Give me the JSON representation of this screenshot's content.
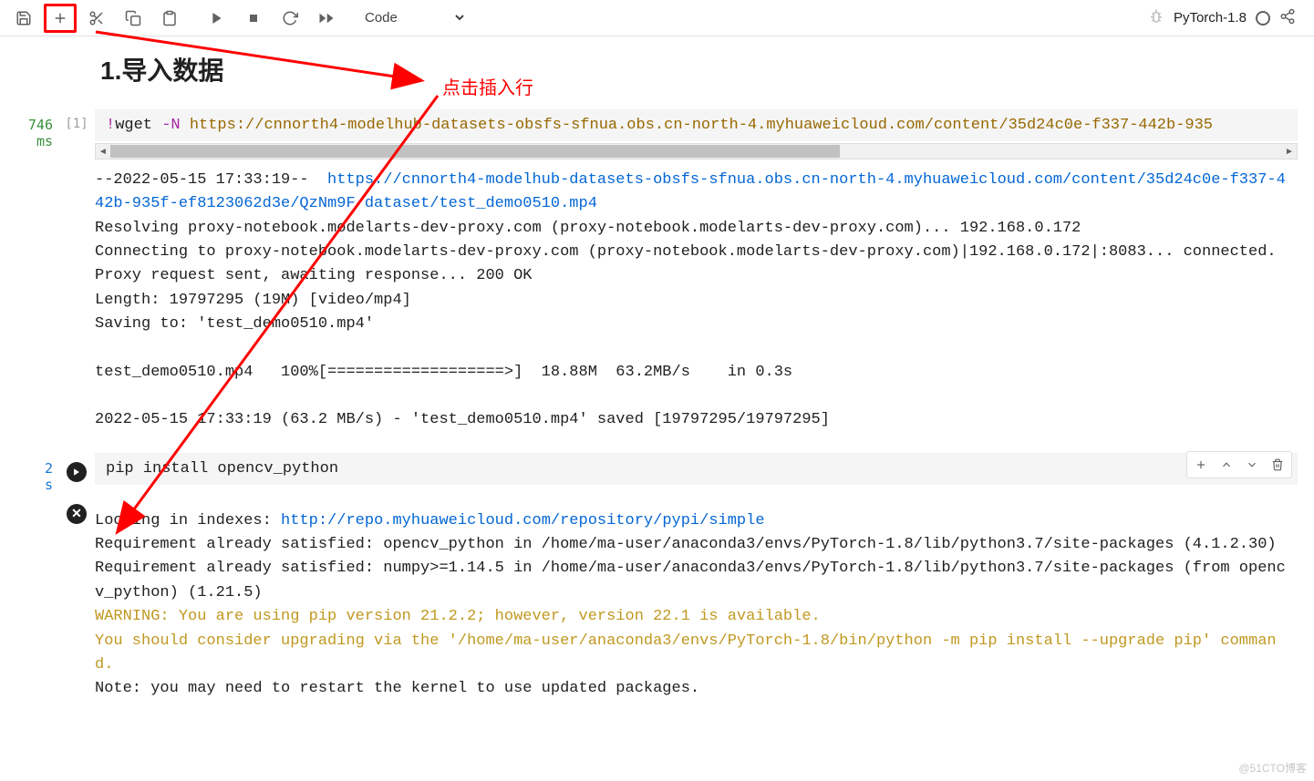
{
  "toolbar": {
    "celltype": "Code",
    "kernel": "PyTorch-1.8"
  },
  "annotation": {
    "text": "点击插入行"
  },
  "markdown": {
    "heading": "1.导入数据"
  },
  "cell1": {
    "exec_time_value": "746",
    "exec_time_unit": "ms",
    "prompt": "[1]",
    "code_prefix": "!",
    "code_cmd": "wget ",
    "code_flag": "-N ",
    "code_url": "https://cnnorth4-modelhub-datasets-obsfs-sfnua.obs.cn-north-4.myhuaweicloud.com/content/35d24c0e-f337-442b-935",
    "output_plain1": "--2022-05-15 17:33:19--  ",
    "output_link": "https://cnnorth4-modelhub-datasets-obsfs-sfnua.obs.cn-north-4.myhuaweicloud.com/content/35d24c0e-f337-442b-935f-ef8123062d3e/QzNm9F/dataset/test_demo0510.mp4",
    "output_rest": "Resolving proxy-notebook.modelarts-dev-proxy.com (proxy-notebook.modelarts-dev-proxy.com)... 192.168.0.172\nConnecting to proxy-notebook.modelarts-dev-proxy.com (proxy-notebook.modelarts-dev-proxy.com)|192.168.0.172|:8083... connected.\nProxy request sent, awaiting response... 200 OK\nLength: 19797295 (19M) [video/mp4]\nSaving to: 'test_demo0510.mp4'\n\ntest_demo0510.mp4   100%[===================>]  18.88M  63.2MB/s    in 0.3s\n\n2022-05-15 17:33:19 (63.2 MB/s) - 'test_demo0510.mp4' saved [19797295/19797295]\n"
  },
  "cell2": {
    "exec_time_value": "2",
    "exec_time_unit": "s",
    "code": "pip install opencv_python",
    "out_prefix": "Looking in indexes: ",
    "out_link": "http://repo.myhuaweicloud.com/repository/pypi/simple",
    "out_body": "\nRequirement already satisfied: opencv_python in /home/ma-user/anaconda3/envs/PyTorch-1.8/lib/python3.7/site-packages (4.1.2.30)\nRequirement already satisfied: numpy>=1.14.5 in /home/ma-user/anaconda3/envs/PyTorch-1.8/lib/python3.7/site-packages (from opencv_python) (1.21.5)\n",
    "out_warn": "WARNING: You are using pip version 21.2.2; however, version 22.1 is available.\nYou should consider upgrading via the '/home/ma-user/anaconda3/envs/PyTorch-1.8/bin/python -m pip install --upgrade pip' command.\n",
    "out_note": "Note: you may need to restart the kernel to use updated packages."
  },
  "watermark": "@51CTO博客"
}
